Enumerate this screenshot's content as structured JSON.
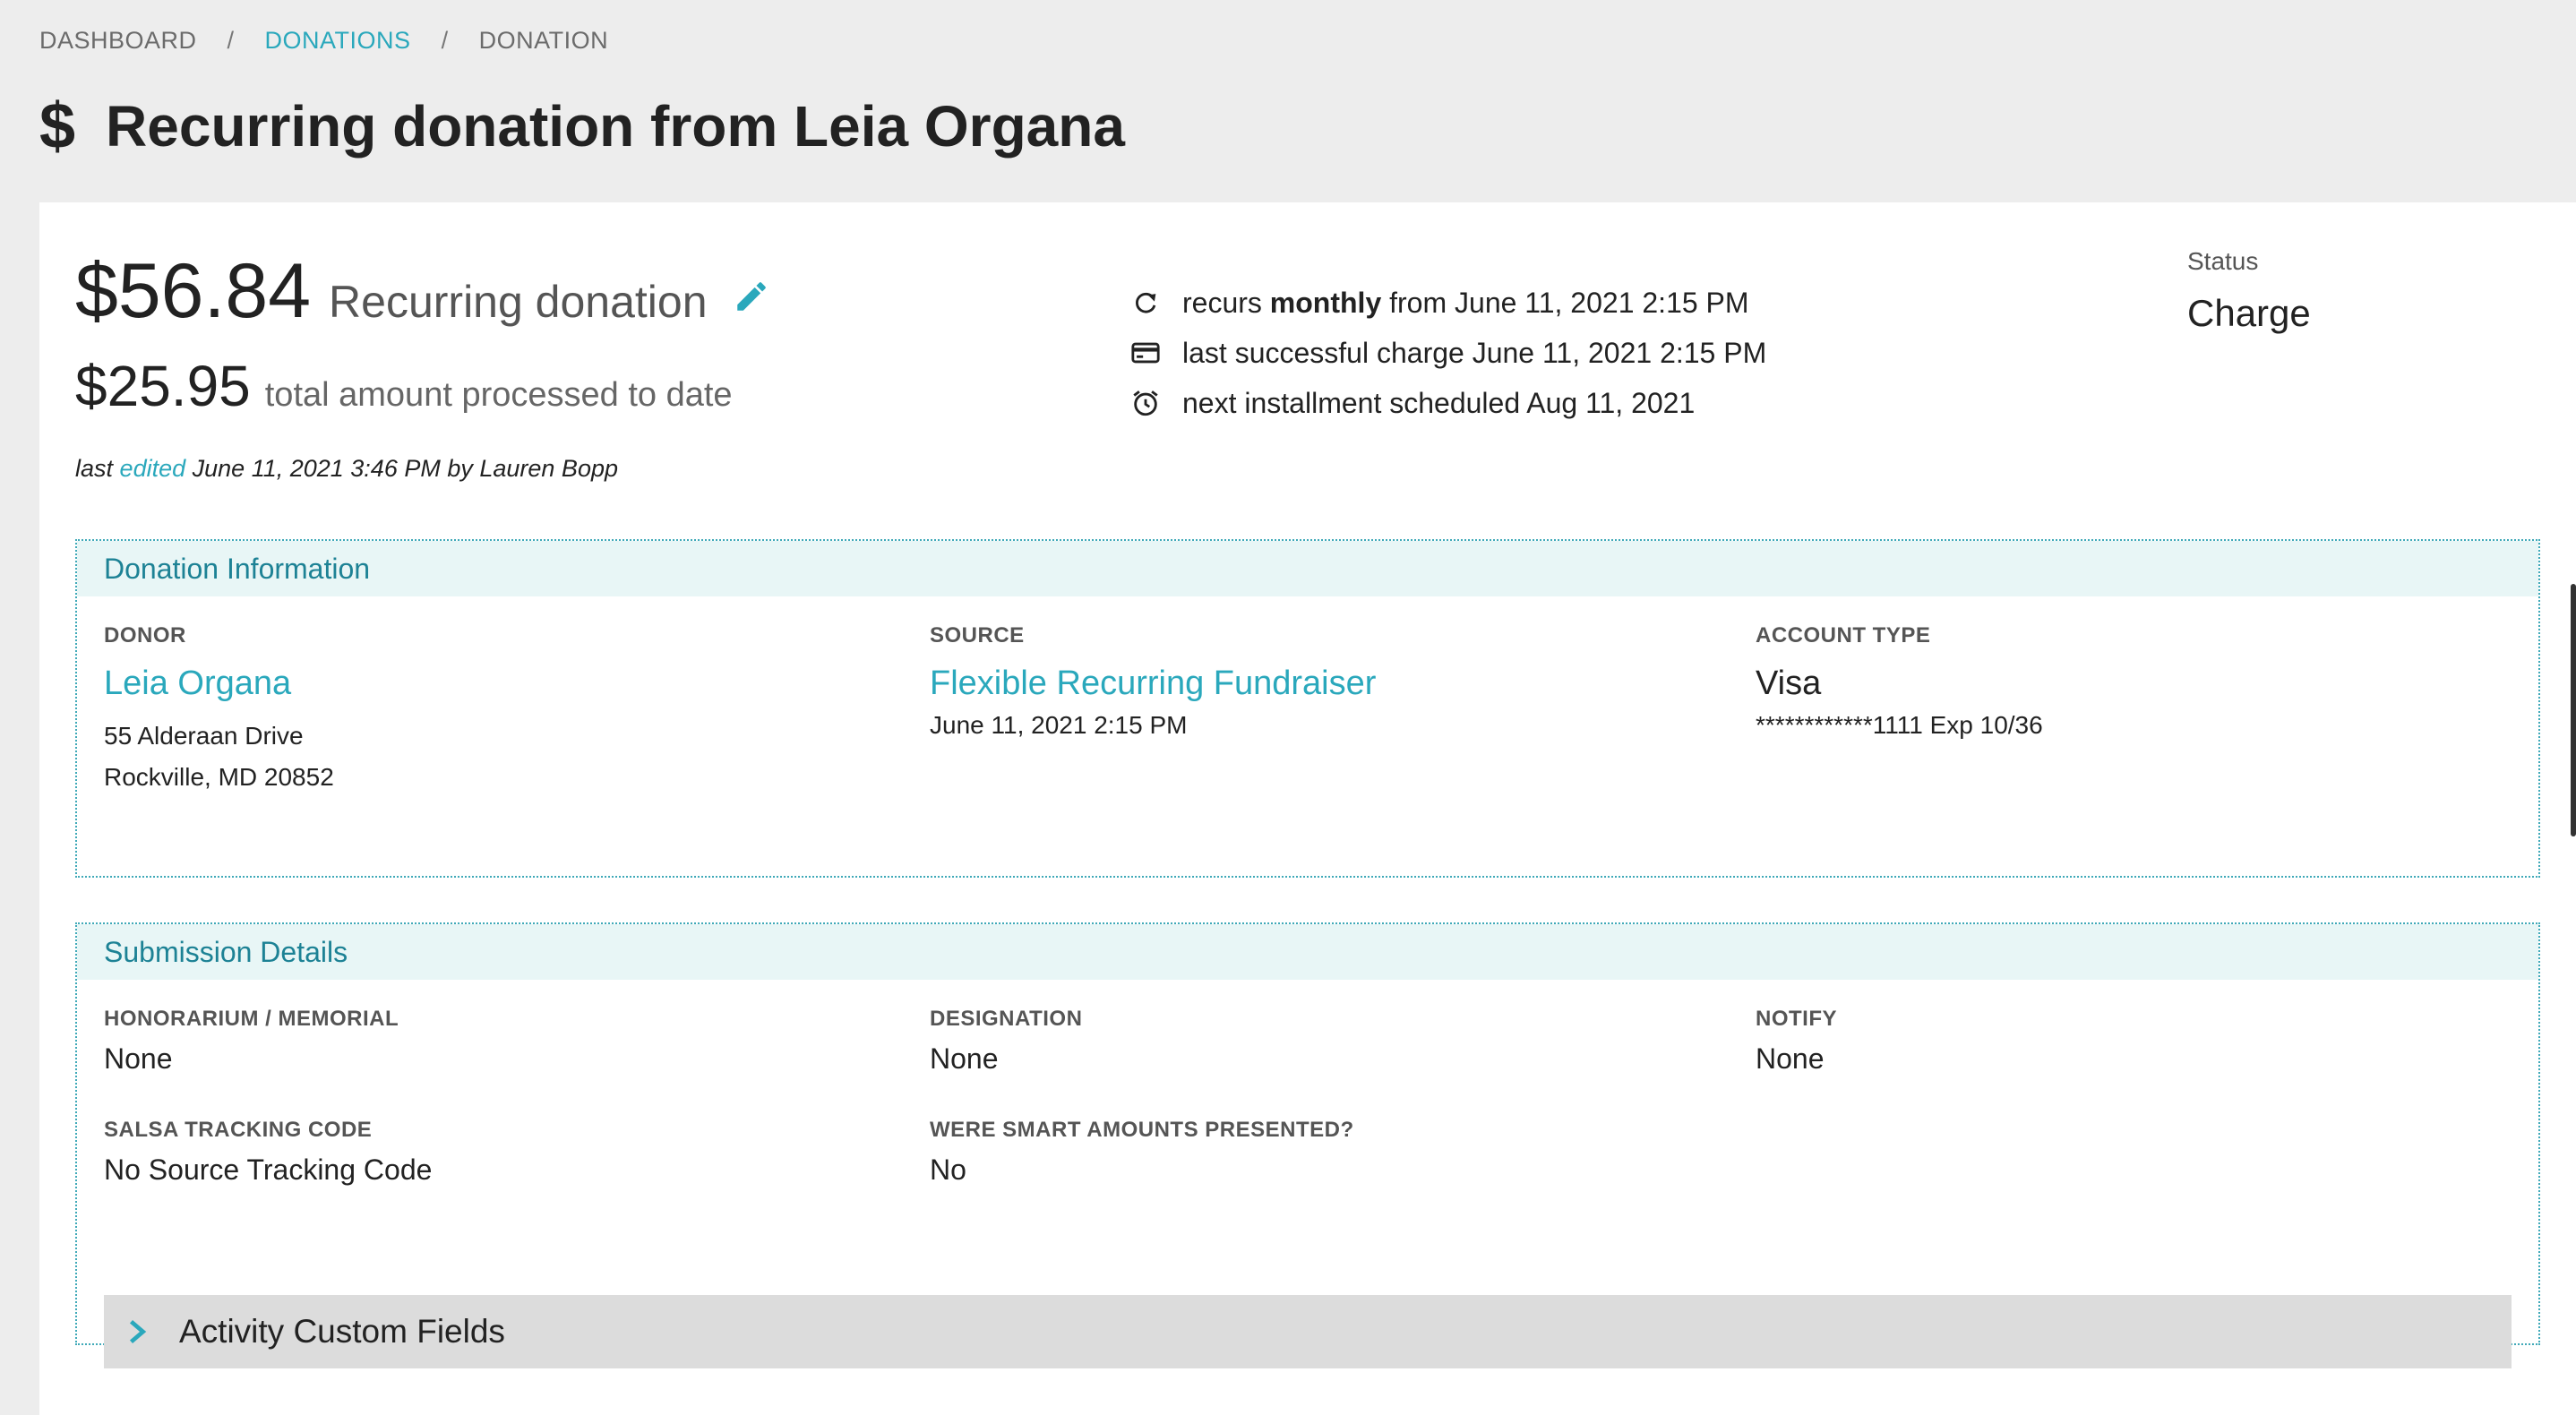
{
  "breadcrumb": {
    "items": [
      "DASHBOARD",
      "DONATIONS",
      "DONATION"
    ],
    "separator": "/"
  },
  "page": {
    "title": "Recurring donation from Leia Organa",
    "icon": "dollar-icon"
  },
  "summary": {
    "amount": "$56.84",
    "type": "Recurring donation",
    "processed_amount": "$25.95",
    "processed_label": "total amount processed to date",
    "last_edited_prefix": "last",
    "last_edited_link": "edited",
    "last_edited_suffix": "June 11, 2021 3:46 PM by Lauren Bopp"
  },
  "recurrence": {
    "recurs_prefix": "recurs",
    "recurs_freq": "monthly",
    "recurs_suffix": "from June 11, 2021 2:15 PM",
    "last_charge": "last successful charge June 11, 2021 2:15 PM",
    "next_installment": "next installment scheduled Aug 11, 2021"
  },
  "status": {
    "label": "Status",
    "value": "Charge"
  },
  "donation_info": {
    "header": "Donation Information",
    "donor_label": "DONOR",
    "donor_name": "Leia Organa",
    "donor_address1": "55 Alderaan Drive",
    "donor_address2": "Rockville, MD 20852",
    "source_label": "SOURCE",
    "source_name": "Flexible Recurring Fundraiser",
    "source_date": "June 11, 2021 2:15 PM",
    "account_label": "ACCOUNT TYPE",
    "account_type": "Visa",
    "account_number": "************1111 Exp 10/36"
  },
  "submission": {
    "header": "Submission Details",
    "honorarium_label": "HONORARIUM / MEMORIAL",
    "honorarium_value": "None",
    "designation_label": "DESIGNATION",
    "designation_value": "None",
    "notify_label": "NOTIFY",
    "notify_value": "None",
    "tracking_label": "SALSA TRACKING CODE",
    "tracking_value": "No Source Tracking Code",
    "smart_label": "WERE SMART AMOUNTS PRESENTED?",
    "smart_value": "No",
    "custom_fields": "Activity Custom Fields"
  },
  "colors": {
    "accent": "#2aa8bc",
    "section_header_bg": "#e8f6f6",
    "page_bg": "#ededed"
  }
}
